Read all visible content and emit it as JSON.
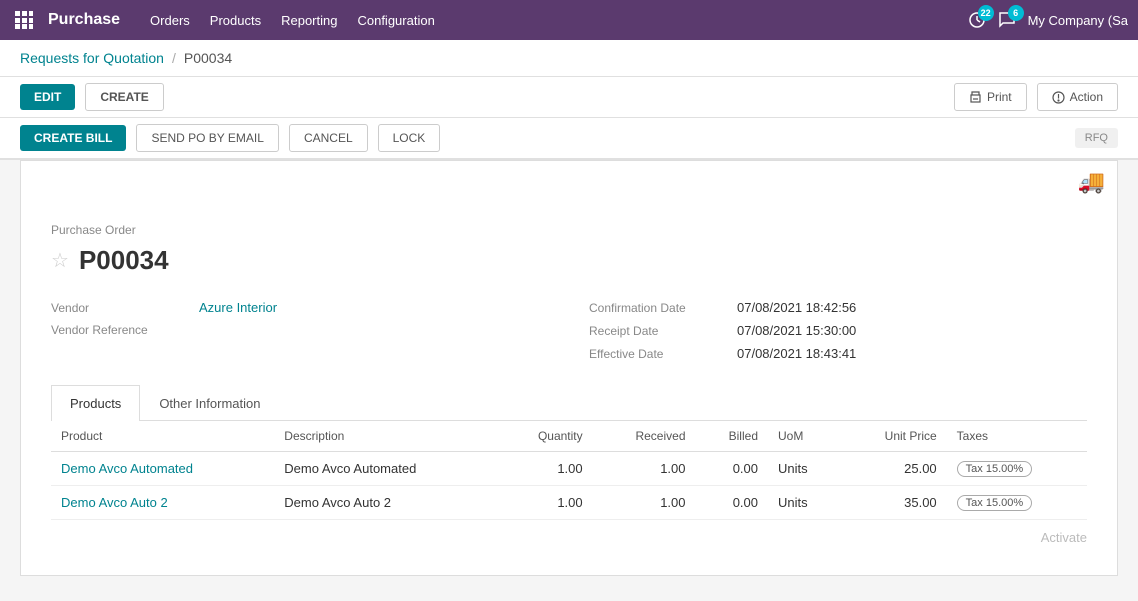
{
  "topnav": {
    "app_name": "Purchase",
    "nav_links": [
      "Orders",
      "Products",
      "Reporting",
      "Configuration"
    ],
    "clock_badge": "22",
    "chat_badge": "6",
    "company": "My Company (Sa"
  },
  "breadcrumb": {
    "parent": "Requests for Quotation",
    "separator": "/",
    "current": "P00034"
  },
  "action_bar": {
    "edit_label": "EDIT",
    "create_label": "CREATE",
    "print_label": "Print",
    "action_label": "Action"
  },
  "secondary_bar": {
    "create_bill_label": "CREATE BILL",
    "send_po_label": "SEND PO BY EMAIL",
    "cancel_label": "CANCEL",
    "lock_label": "LOCK",
    "rfq_label": "RFQ"
  },
  "form": {
    "doc_type_label": "Purchase Order",
    "doc_id": "P00034",
    "vendor_label": "Vendor",
    "vendor_value": "Azure Interior",
    "vendor_ref_label": "Vendor Reference",
    "vendor_ref_placeholder": "",
    "confirmation_date_label": "Confirmation Date",
    "confirmation_date_value": "07/08/2021 18:42:56",
    "receipt_date_label": "Receipt Date",
    "receipt_date_value": "07/08/2021 15:30:00",
    "effective_date_label": "Effective Date",
    "effective_date_value": "07/08/2021 18:43:41"
  },
  "tabs": [
    {
      "label": "Products",
      "active": true
    },
    {
      "label": "Other Information",
      "active": false
    }
  ],
  "table": {
    "columns": [
      "Product",
      "Description",
      "Quantity",
      "Received",
      "Billed",
      "UoM",
      "Unit Price",
      "Taxes"
    ],
    "rows": [
      {
        "product": "Demo Avco Automated",
        "description": "Demo Avco Automated",
        "quantity": "1.00",
        "received": "1.00",
        "billed": "0.00",
        "uom": "Units",
        "unit_price": "25.00",
        "taxes": "Tax 15.00%"
      },
      {
        "product": "Demo Avco Auto 2",
        "description": "Demo Avco Auto 2",
        "quantity": "1.00",
        "received": "1.00",
        "billed": "0.00",
        "uom": "Units",
        "unit_price": "35.00",
        "taxes": "Tax 15.00%"
      }
    ]
  },
  "watermark": "Activate"
}
